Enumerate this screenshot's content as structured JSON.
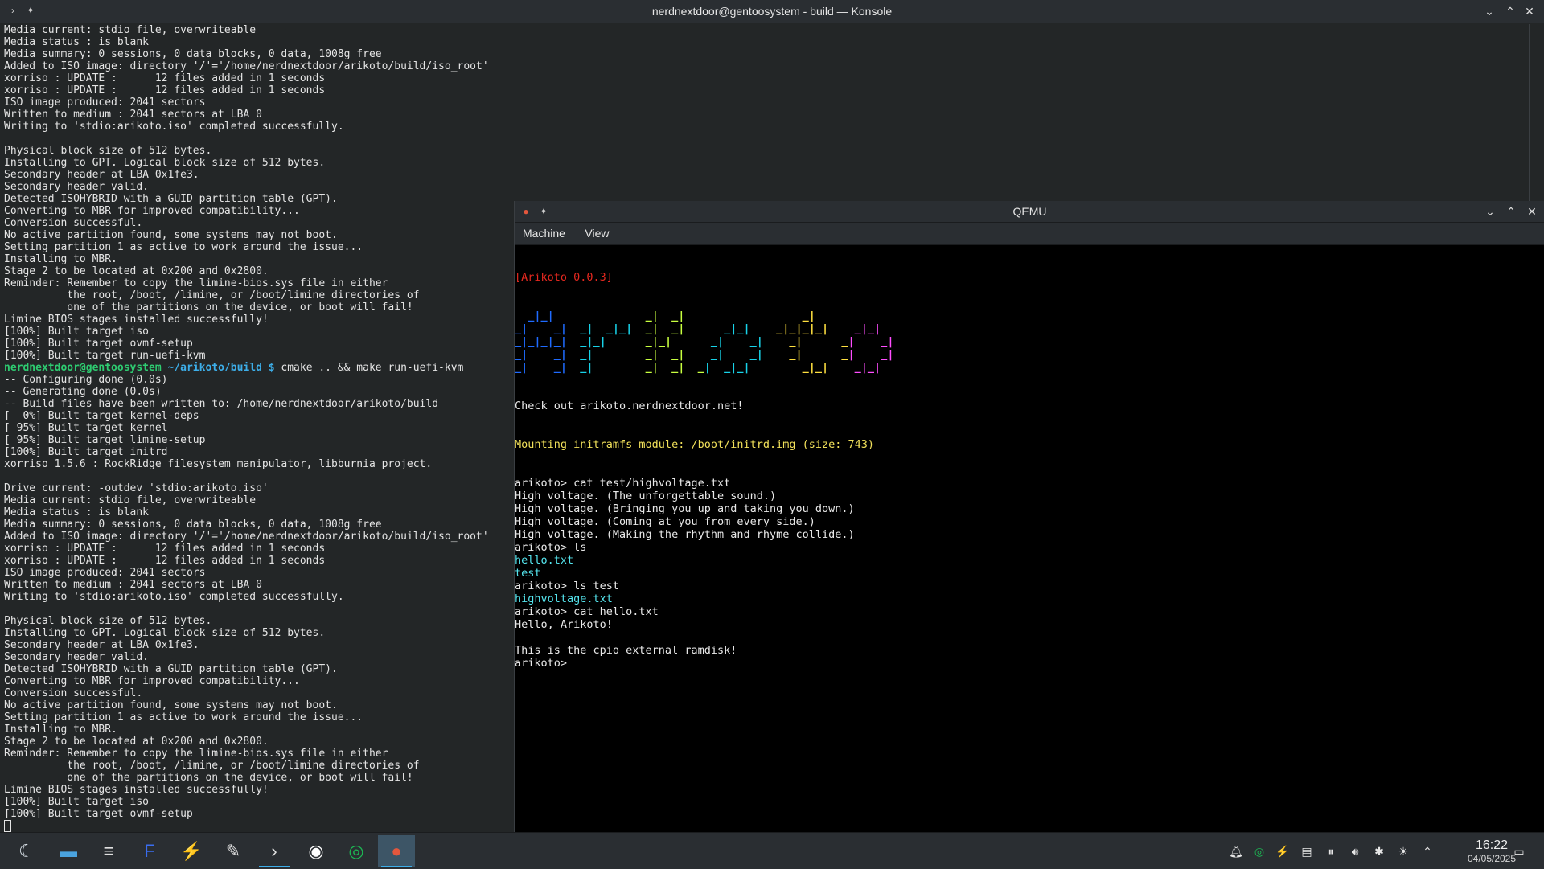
{
  "konsole": {
    "title": "nerdnextdoor@gentoosystem - build — Konsole",
    "lines": [
      "Media current: stdio file, overwriteable",
      "Media status : is blank",
      "Media summary: 0 sessions, 0 data blocks, 0 data, 1008g free",
      "Added to ISO image: directory '/'='/home/nerdnextdoor/arikoto/build/iso_root'",
      "xorriso : UPDATE :      12 files added in 1 seconds",
      "xorriso : UPDATE :      12 files added in 1 seconds",
      "ISO image produced: 2041 sectors",
      "Written to medium : 2041 sectors at LBA 0",
      "Writing to 'stdio:arikoto.iso' completed successfully.",
      "",
      "Physical block size of 512 bytes.",
      "Installing to GPT. Logical block size of 512 bytes.",
      "Secondary header at LBA 0x1fe3.",
      "Secondary header valid.",
      "Detected ISOHYBRID with a GUID partition table (GPT).",
      "Converting to MBR for improved compatibility...",
      "Conversion successful.",
      "No active partition found, some systems may not boot.",
      "Setting partition 1 as active to work around the issue...",
      "Installing to MBR.",
      "Stage 2 to be located at 0x200 and 0x2800.",
      "Reminder: Remember to copy the limine-bios.sys file in either",
      "          the root, /boot, /limine, or /boot/limine directories of",
      "          one of the partitions on the device, or boot will fail!",
      "Limine BIOS stages installed successfully!",
      "[100%] Built target iso",
      "[100%] Built target ovmf-setup",
      "[100%] Built target run-uefi-kvm"
    ],
    "prompt": {
      "user": "nerdnextdoor@gentoosystem",
      "path": "~/arikoto/build $",
      "command": " cmake .. && make run-uefi-kvm"
    },
    "lines2": [
      "-- Configuring done (0.0s)",
      "-- Generating done (0.0s)",
      "-- Build files have been written to: /home/nerdnextdoor/arikoto/build",
      "[  0%] Built target kernel-deps",
      "[ 95%] Built target kernel",
      "[ 95%] Built target limine-setup",
      "[100%] Built target initrd",
      "xorriso 1.5.6 : RockRidge filesystem manipulator, libburnia project.",
      "",
      "Drive current: -outdev 'stdio:arikoto.iso'",
      "Media current: stdio file, overwriteable",
      "Media status : is blank",
      "Media summary: 0 sessions, 0 data blocks, 0 data, 1008g free",
      "Added to ISO image: directory '/'='/home/nerdnextdoor/arikoto/build/iso_root'",
      "xorriso : UPDATE :      12 files added in 1 seconds",
      "xorriso : UPDATE :      12 files added in 1 seconds",
      "ISO image produced: 2041 sectors",
      "Written to medium : 2041 sectors at LBA 0",
      "Writing to 'stdio:arikoto.iso' completed successfully.",
      "",
      "Physical block size of 512 bytes.",
      "Installing to GPT. Logical block size of 512 bytes.",
      "Secondary header at LBA 0x1fe3.",
      "Secondary header valid.",
      "Detected ISOHYBRID with a GUID partition table (GPT).",
      "Converting to MBR for improved compatibility...",
      "Conversion successful.",
      "No active partition found, some systems may not boot.",
      "Setting partition 1 as active to work around the issue...",
      "Installing to MBR.",
      "Stage 2 to be located at 0x200 and 0x2800.",
      "Reminder: Remember to copy the limine-bios.sys file in either",
      "          the root, /boot, /limine, or /boot/limine directories of",
      "          one of the partitions on the device, or boot will fail!",
      "Limine BIOS stages installed successfully!",
      "[100%] Built target iso",
      "[100%] Built target ovmf-setup"
    ]
  },
  "qemu": {
    "title": "QEMU",
    "menu": [
      "Machine",
      "View"
    ],
    "version_line": "[Arikoto 0.0.3]",
    "check_out": "Check out arikoto.nerdnextdoor.net!",
    "mounting": "Mounting initramfs module: /boot/initrd.img (size: 743)",
    "session": [
      {
        "text": "arikoto> cat test/highvoltage.txt",
        "color": "white"
      },
      {
        "text": "High voltage. (The unforgettable sound.)",
        "color": "white"
      },
      {
        "text": "High voltage. (Bringing you up and taking you down.)",
        "color": "white"
      },
      {
        "text": "High voltage. (Coming at you from every side.)",
        "color": "white"
      },
      {
        "text": "High voltage. (Making the rhythm and rhyme collide.)",
        "color": "white"
      },
      {
        "text": "arikoto> ls",
        "color": "white"
      },
      {
        "text": "hello.txt",
        "color": "cyan"
      },
      {
        "text": "test",
        "color": "cyan"
      },
      {
        "text": "arikoto> ls test",
        "color": "white"
      },
      {
        "text": "highvoltage.txt",
        "color": "cyan"
      },
      {
        "text": "arikoto> cat hello.txt",
        "color": "white"
      },
      {
        "text": "Hello, Arikoto!",
        "color": "white"
      },
      {
        "text": "",
        "color": "white"
      },
      {
        "text": "This is the cpio external ramdisk!",
        "color": "white"
      },
      {
        "text": "arikoto> ",
        "color": "white"
      }
    ],
    "ascii_art": [
      "  _|_|              _|  _|                  _|",
      "_|    _|  _|  _|_|  _|  _|      _|_|    _|_|_|_|    _|_|",
      "_|_|_|_|  _|_|      _|_|      _|    _|    _|      _|    _|",
      "_|    _|  _|        _|  _|    _|    _|    _|      _|    _|",
      "_|    _|  _|        _|  _|  _|  _|_|        _|_|    _|_|"
    ]
  },
  "taskbar": {
    "apps": [
      {
        "name": "app-launcher",
        "glyph": "☾"
      },
      {
        "name": "dolphin",
        "glyph": "▬"
      },
      {
        "name": "system-settings",
        "glyph": "≡"
      },
      {
        "name": "firefox",
        "glyph": "F"
      },
      {
        "name": "vscode",
        "glyph": "⚡"
      },
      {
        "name": "text-editor",
        "glyph": "✎"
      },
      {
        "name": "konsole",
        "glyph": "›"
      },
      {
        "name": "github-desktop",
        "glyph": "◉"
      },
      {
        "name": "spotify",
        "glyph": "◎"
      },
      {
        "name": "qemu",
        "glyph": "●"
      }
    ],
    "clock_time": "16:22",
    "clock_date": "04/05/2025"
  }
}
